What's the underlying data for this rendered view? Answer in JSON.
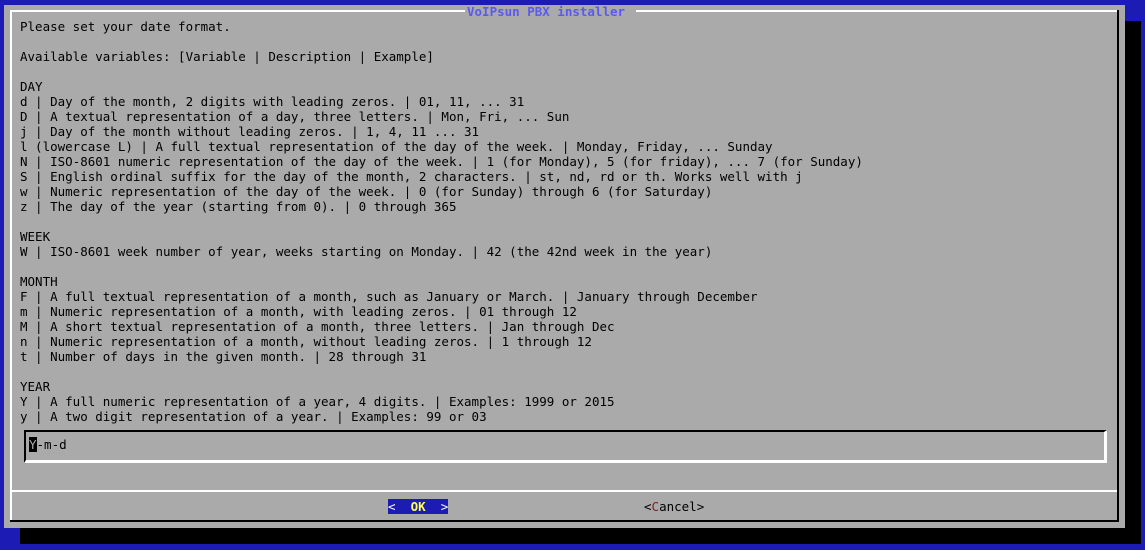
{
  "window": {
    "title": "VoIPsun PBX installer"
  },
  "prompt": {
    "lines": [
      "Please set your date format.",
      "",
      "Available variables: [Variable | Description | Example]",
      "",
      "DAY",
      "d | Day of the month, 2 digits with leading zeros. | 01, 11, ... 31",
      "D | A textual representation of a day, three letters. | Mon, Fri, ... Sun",
      "j | Day of the month without leading zeros. | 1, 4, 11 ... 31",
      "l (lowercase L) | A full textual representation of the day of the week. | Monday, Friday, ... Sunday",
      "N | ISO-8601 numeric representation of the day of the week. | 1 (for Monday), 5 (for friday), ... 7 (for Sunday)",
      "S | English ordinal suffix for the day of the month, 2 characters. | st, nd, rd or th. Works well with j",
      "w | Numeric representation of the day of the week. | 0 (for Sunday) through 6 (for Saturday)",
      "z | The day of the year (starting from 0). | 0 through 365",
      "",
      "WEEK",
      "W | ISO-8601 week number of year, weeks starting on Monday. | 42 (the 42nd week in the year)",
      "",
      "MONTH",
      "F | A full textual representation of a month, such as January or March. | January through December",
      "m | Numeric representation of a month, with leading zeros. | 01 through 12",
      "M | A short textual representation of a month, three letters. | Jan through Dec",
      "n | Numeric representation of a month, without leading zeros. | 1 through 12",
      "t | Number of days in the given month. | 28 through 31",
      "",
      "YEAR",
      "Y | A full numeric representation of a year, 4 digits. | Examples: 1999 or 2015",
      "y | A two digit representation of a year. | Examples: 99 or 03"
    ]
  },
  "input": {
    "value_first_char": "Y",
    "value_rest": "-m-d"
  },
  "buttons": {
    "ok": {
      "left": "<  ",
      "hot": "OK",
      "right": "  >"
    },
    "cancel": {
      "left": "<",
      "hot": "C",
      "rest": "ancel",
      "right": ">"
    }
  },
  "colors": {
    "background": "#1c1cb4",
    "dialog": "#aaaaaa",
    "title": "#5a5af0",
    "button_selected_bg": "#1c1cb4",
    "hotkey_selected": "#ffff55",
    "hotkey_unselected": "#8b1c1c"
  }
}
